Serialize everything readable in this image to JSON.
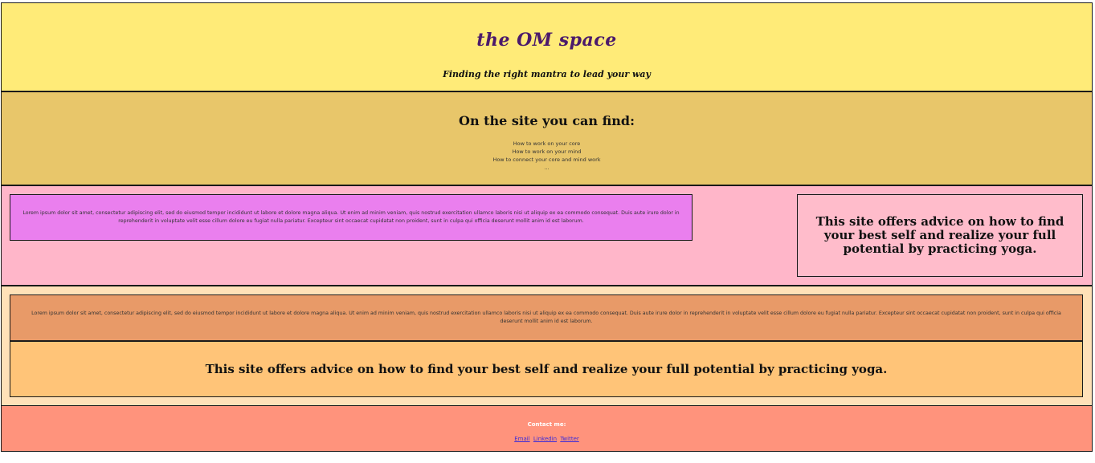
{
  "header": {
    "site_title": "the OM space",
    "tagline": "Finding the right mantra to lead your way"
  },
  "features": {
    "heading": "On the site you can find:",
    "items": [
      "How to work on your core",
      "How to work on your mind",
      "How to connect your core and mind work",
      "..."
    ]
  },
  "row1": {
    "lorem": "Lorem ipsum dolor sit amet, consectetur adipiscing elit, sed do eiusmod tempor incididunt ut labore et dolore magna aliqua. Ut enim ad minim veniam, quis nostrud exercitation ullamco laboris nisi ut aliquip ex ea commodo consequat. Duis aute irure dolor in reprehenderit in voluptate velit esse cillum dolore eu fugiat nulla pariatur. Excepteur sint occaecat cupidatat non proident, sunt in culpa qui officia deserunt mollit anim id est laborum.",
    "offer": "This site offers advice on how to find your best self and realize your full potential by practicing yoga."
  },
  "row2": {
    "lorem": "Lorem ipsum dolor sit amet, consectetur adipiscing elit, sed do eiusmod tempor incididunt ut labore et dolore magna aliqua. Ut enim ad minim veniam, quis nostrud exercitation ullamco laboris nisi ut aliquip ex ea commodo consequat. Duis aute irure dolor in reprehenderit in voluptate velit esse cillum dolore eu fugiat nulla pariatur. Excepteur sint occaecat cupidatat non proident, sunt in culpa qui officia deserunt mollit anim id est laborum.",
    "offer": "This site offers advice on how to find your best self and realize your full potential by practicing yoga."
  },
  "footer": {
    "contact_label": "Contact me:",
    "links": [
      "Email",
      "Linkedin",
      "Twitter"
    ]
  },
  "colors": {
    "header_bg": "#ffeb78",
    "features_bg": "#e8c66a",
    "row1_bg": "#ffb6c9",
    "row1_lorem_bg": "#ea7fee",
    "row1_offer_bg": "#ffbccb",
    "row2_bg": "#ffe1b8",
    "row2_lorem_bg": "#e89a68",
    "row2_offer_bg": "#ffc478",
    "footer_bg": "#ff937c",
    "title_color": "#4b1a6b",
    "link_color": "#3b2bd8"
  }
}
